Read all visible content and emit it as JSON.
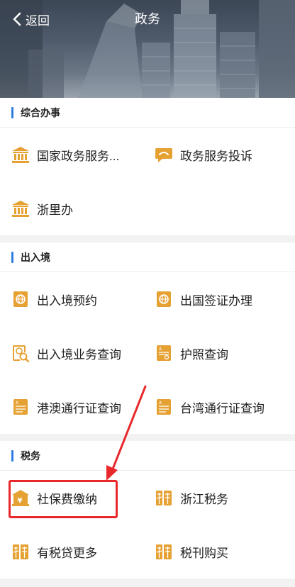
{
  "nav": {
    "back_label": "返回",
    "title": "政务"
  },
  "sections": [
    {
      "title": "综合办事",
      "rows": [
        [
          {
            "label": "国家政务服务...",
            "icon": "government-building-icon"
          },
          {
            "label": "政务服务投诉",
            "icon": "chat-bubble-icon"
          }
        ],
        [
          {
            "label": "浙里办",
            "icon": "government-building-icon"
          }
        ]
      ]
    },
    {
      "title": "出入境",
      "rows": [
        [
          {
            "label": "出入境预约",
            "icon": "passport-globe-icon"
          },
          {
            "label": "出国签证办理",
            "icon": "passport-globe-icon"
          }
        ],
        [
          {
            "label": "出入境业务查询",
            "icon": "passport-search-icon"
          },
          {
            "label": "护照查询",
            "icon": "document-icon"
          }
        ],
        [
          {
            "label": "港澳通行证查询",
            "icon": "document-lines-icon"
          },
          {
            "label": "台湾通行证查询",
            "icon": "document-lines-icon"
          }
        ]
      ]
    },
    {
      "title": "税务",
      "rows": [
        [
          {
            "label": "社保费缴纳",
            "icon": "yuan-building-icon"
          },
          {
            "label": "浙江税务",
            "icon": "tax-icon"
          }
        ],
        [
          {
            "label": "有税贷更多",
            "icon": "tax-icon"
          },
          {
            "label": "税刊购买",
            "icon": "tax-icon"
          }
        ]
      ]
    }
  ],
  "colors": {
    "icon_orange": "#e6a133",
    "accent_blue": "#2f7de1",
    "highlight_red": "#e8282b"
  }
}
